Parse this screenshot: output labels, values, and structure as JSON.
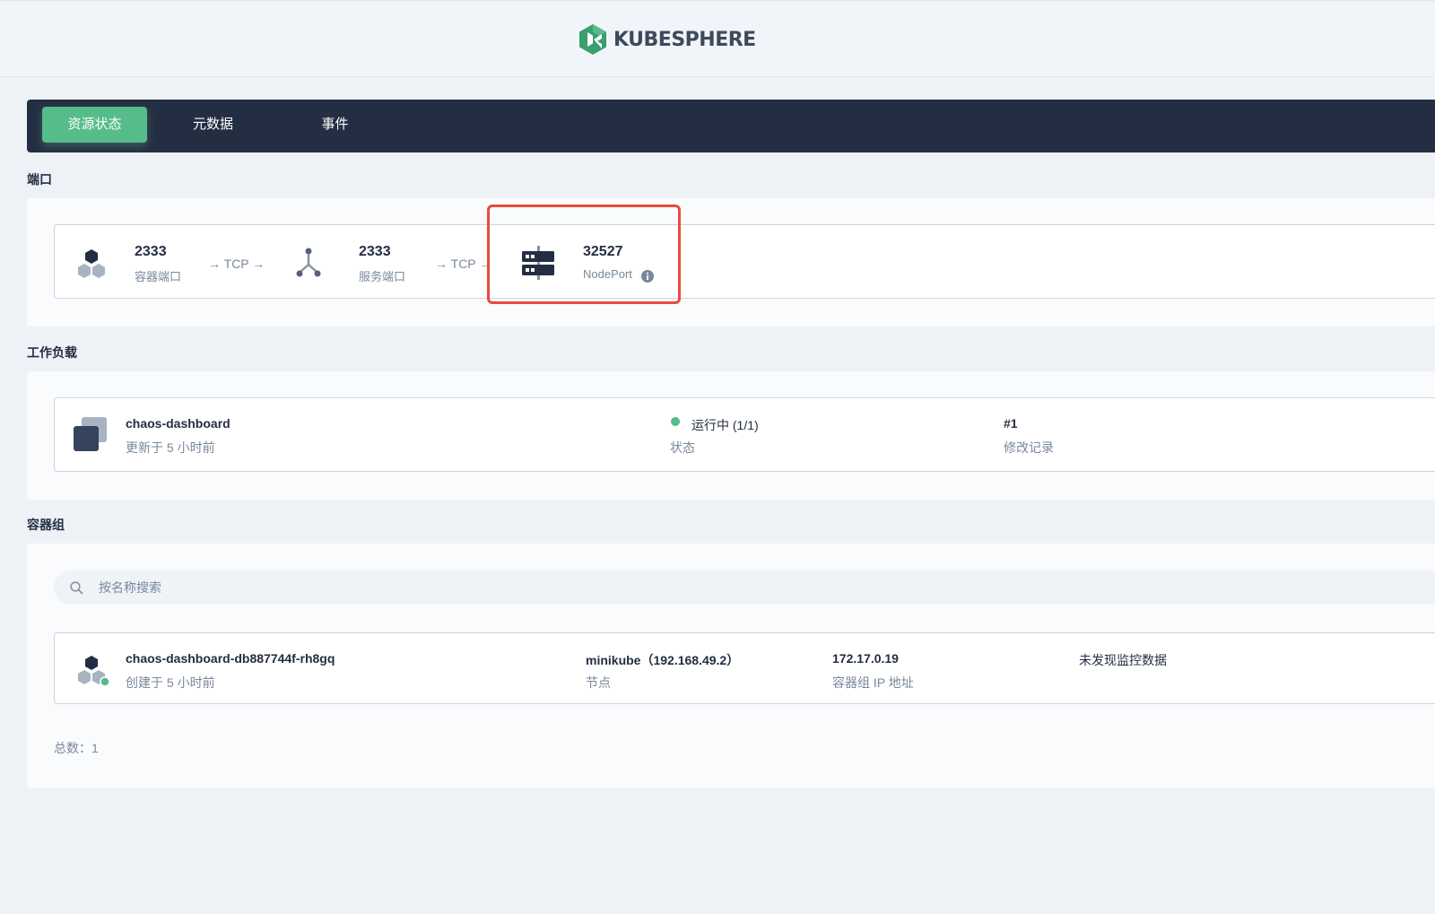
{
  "logo": {
    "text": "KUBESPHERE"
  },
  "tabs": [
    {
      "label": "资源状态",
      "active": true
    },
    {
      "label": "元数据",
      "active": false
    },
    {
      "label": "事件",
      "active": false
    }
  ],
  "ports": {
    "title": "端口",
    "container_port": {
      "value": "2333",
      "label": "容器端口"
    },
    "arrow1": "→ TCP →",
    "service_port": {
      "value": "2333",
      "label": "服务端口"
    },
    "arrow2": "→ TCP →",
    "node_port": {
      "value": "32527",
      "label": "NodePort"
    }
  },
  "workload": {
    "title": "工作负载",
    "name": "chaos-dashboard",
    "updated": "更新于 5 小时前",
    "status_value": "运行中 (1/1)",
    "status_label": "状态",
    "revision_value": "#1",
    "revision_label": "修改记录"
  },
  "pods": {
    "title": "容器组",
    "search_placeholder": "按名称搜索",
    "items": [
      {
        "name": "chaos-dashboard-db887744f-rh8gq",
        "created": "创建于 5 小时前",
        "node_value": "minikube（192.168.49.2）",
        "node_label": "节点",
        "ip_value": "172.17.0.19",
        "ip_label": "容器组 IP 地址",
        "monitor": "未发现监控数据"
      }
    ],
    "total": "总数：1"
  },
  "colors": {
    "accent": "#55bc8a",
    "nav_bg": "#242e42",
    "highlight": "#e74c3c",
    "text": "#242e42",
    "muted": "#79879c"
  }
}
